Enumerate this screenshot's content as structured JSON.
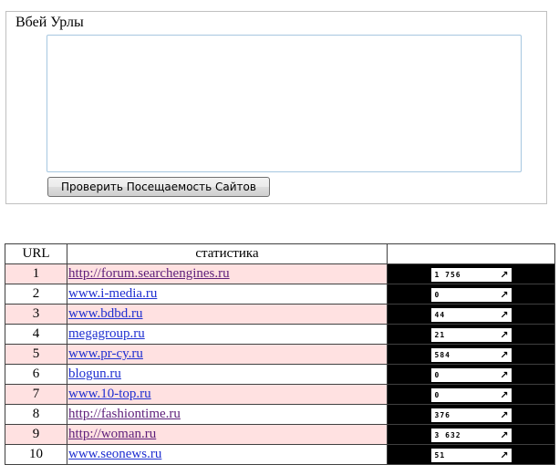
{
  "form": {
    "legend": "Вбей Урлы",
    "textarea_value": "",
    "button_label": "Проверить Посещаемость Сайтов"
  },
  "table": {
    "headers": [
      "URL",
      "статистика",
      ""
    ],
    "rows": [
      {
        "num": "1",
        "site": "http://forum.searchengines.ru",
        "count": "1 756",
        "visited": true
      },
      {
        "num": "2",
        "site": "www.i-media.ru",
        "count": "0",
        "visited": false
      },
      {
        "num": "3",
        "site": "www.bdbd.ru",
        "count": "44",
        "visited": false
      },
      {
        "num": "4",
        "site": "megagroup.ru",
        "count": "21",
        "visited": false
      },
      {
        "num": "5",
        "site": "www.pr-cy.ru",
        "count": "584",
        "visited": false
      },
      {
        "num": "6",
        "site": "blogun.ru",
        "count": "0",
        "visited": false
      },
      {
        "num": "7",
        "site": "www.10-top.ru",
        "count": "0",
        "visited": false
      },
      {
        "num": "8",
        "site": "http://fashiontime.ru",
        "count": "376",
        "visited": true
      },
      {
        "num": "9",
        "site": "http://woman.ru",
        "count": "3 632",
        "visited": true
      },
      {
        "num": "10",
        "site": "www.seonews.ru",
        "count": "51",
        "visited": false
      }
    ],
    "counter_icon": "arrow-up-right-icon"
  }
}
